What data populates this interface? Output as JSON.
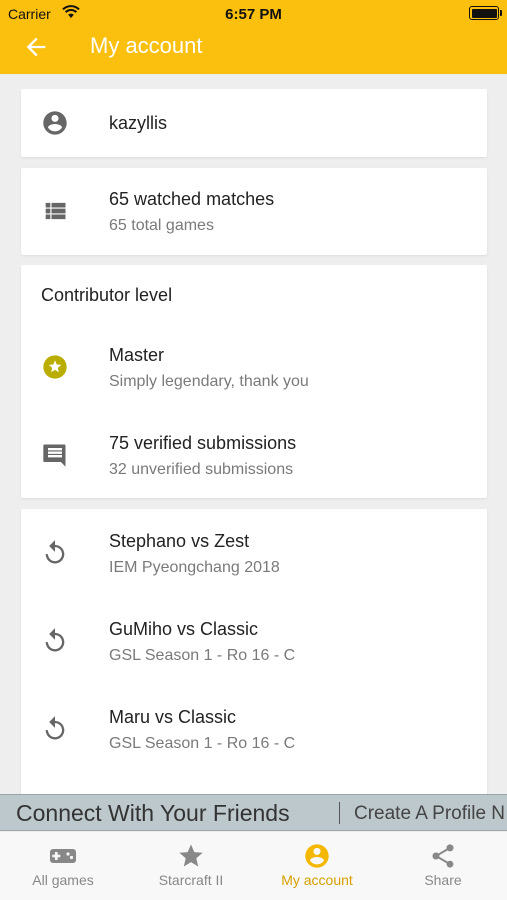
{
  "status_bar": {
    "carrier": "Carrier",
    "time": "6:57 PM"
  },
  "app_bar": {
    "title": "My account"
  },
  "profile": {
    "username": "kazyllis"
  },
  "matches": {
    "watched": "65 watched matches",
    "total": "65 total games"
  },
  "contributor": {
    "heading": "Contributor level",
    "level": "Master",
    "level_desc": "Simply legendary, thank you",
    "verified": "75 verified submissions",
    "unverified": "32 unverified submissions"
  },
  "history": [
    {
      "title": "Stephano vs Zest",
      "event": "IEM Pyeongchang 2018"
    },
    {
      "title": "GuMiho vs Classic",
      "event": "GSL Season 1 - Ro 16 - C"
    },
    {
      "title": "Maru vs Classic",
      "event": "GSL Season 1 - Ro 16 - C"
    }
  ],
  "banner": {
    "text": "Connect With Your Friends",
    "cta": "Create A Profile N"
  },
  "tabs": [
    {
      "label": "All games",
      "icon": "gamepad-icon"
    },
    {
      "label": "Starcraft II",
      "icon": "star-icon"
    },
    {
      "label": "My account",
      "icon": "account-icon",
      "active": true
    },
    {
      "label": "Share",
      "icon": "share-icon"
    }
  ],
  "colors": {
    "accent": "#fbbf0e",
    "active_tab": "#d79f00",
    "master_badge": "#b9ad00"
  }
}
